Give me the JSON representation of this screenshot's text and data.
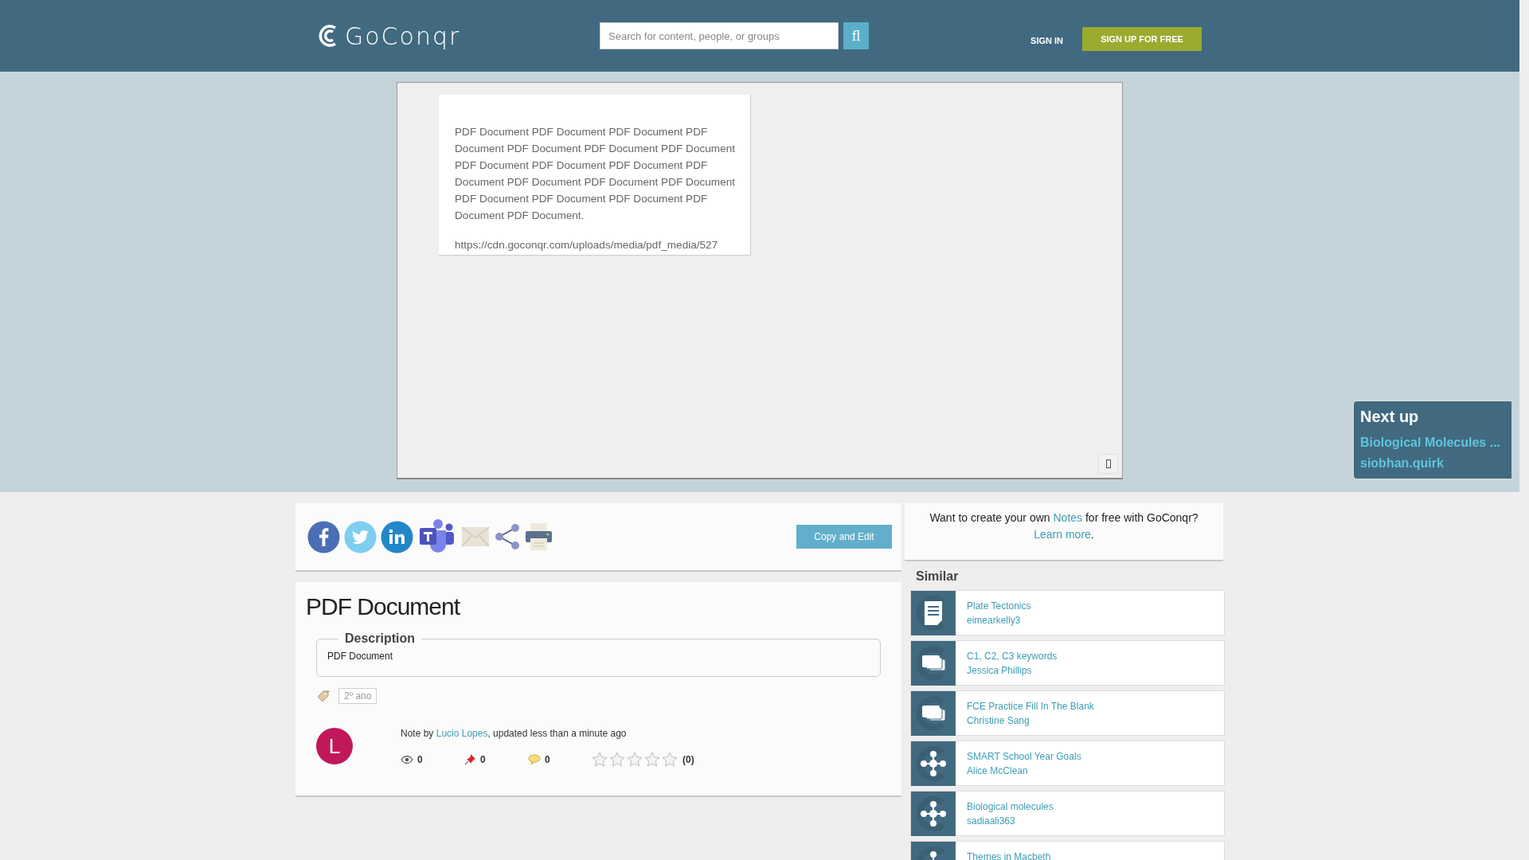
{
  "header": {
    "logo": "GoConqr",
    "search": {
      "placeholder": "Search for content, people, or groups"
    },
    "search_button": "fl",
    "sign_in": "SIGN IN",
    "sign_up": "SIGN UP FOR FREE"
  },
  "viewer": {
    "paragraph": "PDF Document PDF Document PDF Document PDF Document PDF Document PDF Document PDF Document PDF Document PDF Document PDF Document PDF Document PDF Document PDF Document PDF Document PDF Document PDF Document PDF Document PDF Document PDF Document.",
    "url": "https://cdn.goconqr.com/uploads/media/pdf_media/527"
  },
  "next_up": {
    "heading": "Next up",
    "title": "Biological Molecules ...",
    "author": "siobhan.quirk"
  },
  "share": {
    "copy_button": "Copy and Edit"
  },
  "note": {
    "title": "PDF Document",
    "description_label": "Description",
    "description": "PDF Document",
    "tag": "2º ano",
    "avatar": "L",
    "byline_prefix": "Note by ",
    "byline_author": "Lucio Lopes",
    "byline_suffix": ", updated less than a minute ago",
    "views": "0",
    "pins": "0",
    "comments": "0",
    "stars": 0,
    "rating_count": "(0)"
  },
  "promo": {
    "before": "Want to create your own ",
    "link": "Notes",
    "middle": " for free with GoConqr? ",
    "link2": "Learn more",
    "after": "."
  },
  "similar": {
    "heading": "Similar",
    "items": [
      {
        "kind": "note",
        "title": "Plate Tectonics",
        "author": "eimearkelly3"
      },
      {
        "kind": "flashcards",
        "title": "C1, C2, C3 keywords",
        "author": "Jessica Phillips"
      },
      {
        "kind": "flashcards",
        "title": "FCE Practice Fill In The Blank",
        "author": "Christine Sang"
      },
      {
        "kind": "mindmap",
        "title": "SMART School Year Goals",
        "author": "Alice McClean"
      },
      {
        "kind": "mindmap",
        "title": "Biological molecules",
        "author": "sadiaali363"
      },
      {
        "kind": "mindmap",
        "title": "Themes in Macbeth"
      }
    ]
  }
}
